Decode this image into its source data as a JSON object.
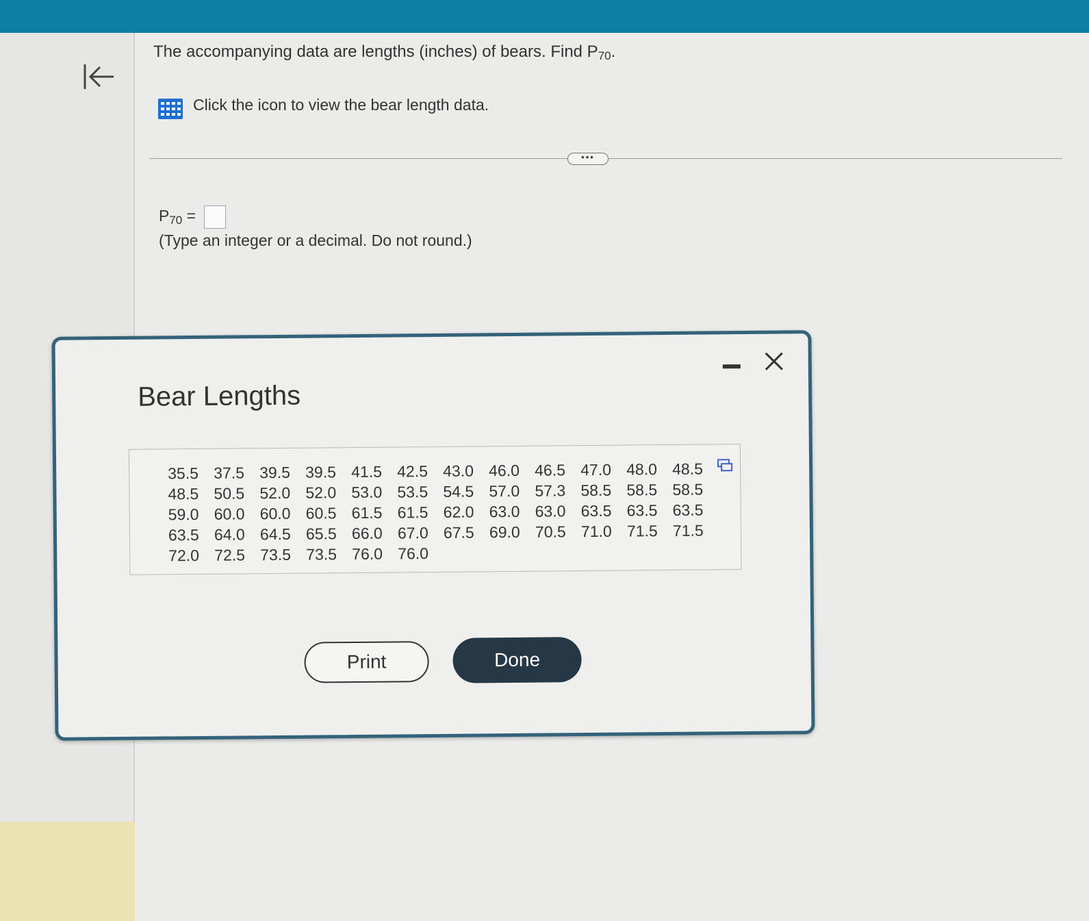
{
  "question": {
    "prefix": "The accompanying data are lengths (inches) of bears. Find P",
    "percentile": "70",
    "suffix": "."
  },
  "hint": "Click the icon to view the bear length data.",
  "more_button": "•••",
  "answer": {
    "label": "P",
    "percentile": "70",
    "equals": "=",
    "value": "",
    "instruction": "(Type an integer or a decimal. Do not round.)"
  },
  "icons": {
    "back": "collapse-left-icon",
    "data_table": "grid-table-icon",
    "copy": "copy-icon",
    "minimize": "minimize-icon",
    "close": "close-icon"
  },
  "colors": {
    "top_bar": "#0d7fa3",
    "dialog_border": "#35627b",
    "done_button": "#263746",
    "grid_icon": "#1f6fd1"
  },
  "dialog": {
    "title": "Bear Lengths",
    "rows": [
      [
        "35.5",
        "37.5",
        "39.5",
        "39.5",
        "41.5",
        "42.5",
        "43.0",
        "46.0",
        "46.5",
        "47.0",
        "48.0",
        "48.5"
      ],
      [
        "48.5",
        "50.5",
        "52.0",
        "52.0",
        "53.0",
        "53.5",
        "54.5",
        "57.0",
        "57.3",
        "58.5",
        "58.5",
        "58.5"
      ],
      [
        "59.0",
        "60.0",
        "60.0",
        "60.5",
        "61.5",
        "61.5",
        "62.0",
        "63.0",
        "63.0",
        "63.5",
        "63.5",
        "63.5"
      ],
      [
        "63.5",
        "64.0",
        "64.5",
        "65.5",
        "66.0",
        "67.0",
        "67.5",
        "69.0",
        "70.5",
        "71.0",
        "71.5",
        "71.5"
      ],
      [
        "72.0",
        "72.5",
        "73.5",
        "73.5",
        "76.0",
        "76.0"
      ]
    ],
    "print_label": "Print",
    "done_label": "Done"
  }
}
